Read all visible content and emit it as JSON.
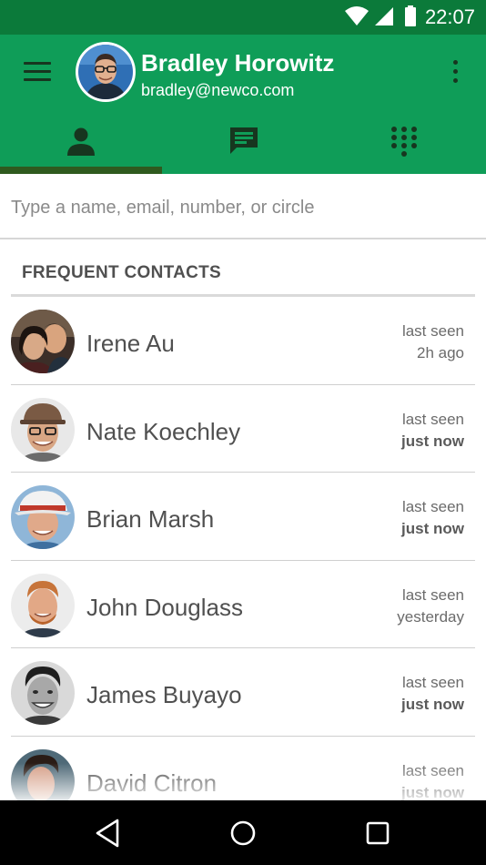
{
  "status_bar": {
    "time": "22:07",
    "icons": [
      "wifi-icon",
      "signal-icon",
      "battery-icon"
    ]
  },
  "colors": {
    "status_bar": "#0b7a3a",
    "app_bar": "#0f9d58",
    "tab_indicator": "#2f5a1f",
    "icon_dark": "#17361f"
  },
  "header": {
    "menu_icon": "menu-icon",
    "name": "Bradley Horowitz",
    "email": "bradley@newco.com",
    "overflow_icon": "more-vert-icon"
  },
  "tabs": [
    {
      "icon": "person-icon",
      "selected": true
    },
    {
      "icon": "chat-icon",
      "selected": false
    },
    {
      "icon": "dialpad-icon",
      "selected": false
    }
  ],
  "search": {
    "placeholder": "Type a name, email, number, or circle",
    "value": ""
  },
  "section": {
    "title": "FREQUENT CONTACTS"
  },
  "contacts": [
    {
      "name": "Irene Au",
      "seen_label": "last seen",
      "seen_value": "2h ago",
      "bold": false
    },
    {
      "name": "Nate Koechley",
      "seen_label": "last seen",
      "seen_value": "just now",
      "bold": true
    },
    {
      "name": "Brian Marsh",
      "seen_label": "last seen",
      "seen_value": "just now",
      "bold": true
    },
    {
      "name": "John Douglass",
      "seen_label": "last seen",
      "seen_value": "yesterday",
      "bold": false
    },
    {
      "name": "James Buyayo",
      "seen_label": "last seen",
      "seen_value": "just now",
      "bold": true
    },
    {
      "name": "David Citron",
      "seen_label": "last seen",
      "seen_value": "just now",
      "bold": true
    }
  ],
  "nav_bar": {
    "buttons": [
      "back-icon",
      "home-icon",
      "recents-icon"
    ]
  }
}
